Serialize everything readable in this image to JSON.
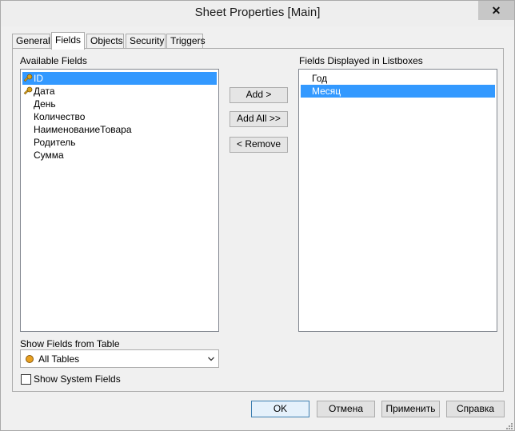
{
  "window": {
    "title": "Sheet Properties [Main]",
    "close_glyph": "✕"
  },
  "tabs": [
    "General",
    "Fields",
    "Objects",
    "Security",
    "Triggers"
  ],
  "available_fields": {
    "label": "Available Fields",
    "items": [
      {
        "text": "ID",
        "key": true,
        "selected": true
      },
      {
        "text": "Дата",
        "key": true,
        "selected": false
      },
      {
        "text": "День",
        "key": false,
        "selected": false
      },
      {
        "text": "Количество",
        "key": false,
        "selected": false
      },
      {
        "text": "НаименованиеТовара",
        "key": false,
        "selected": false
      },
      {
        "text": "Родитель",
        "key": false,
        "selected": false
      },
      {
        "text": "Сумма",
        "key": false,
        "selected": false
      }
    ]
  },
  "displayed_fields": {
    "label": "Fields Displayed in Listboxes",
    "items": [
      {
        "text": "Год",
        "selected": false
      },
      {
        "text": "Месяц",
        "selected": true
      }
    ]
  },
  "buttons": {
    "add": "Add >",
    "add_all": "Add All >>",
    "remove": "< Remove"
  },
  "show_fields": {
    "label": "Show Fields from Table",
    "value": "All Tables"
  },
  "system_fields": {
    "label": "Show System Fields",
    "checked": false
  },
  "footer": {
    "ok": "OK",
    "cancel": "Отмена",
    "apply": "Применить",
    "help": "Справка"
  },
  "colors": {
    "selection": "#3399ff",
    "key_icon": "#d9a21b",
    "table_dot": "#e8a020"
  }
}
